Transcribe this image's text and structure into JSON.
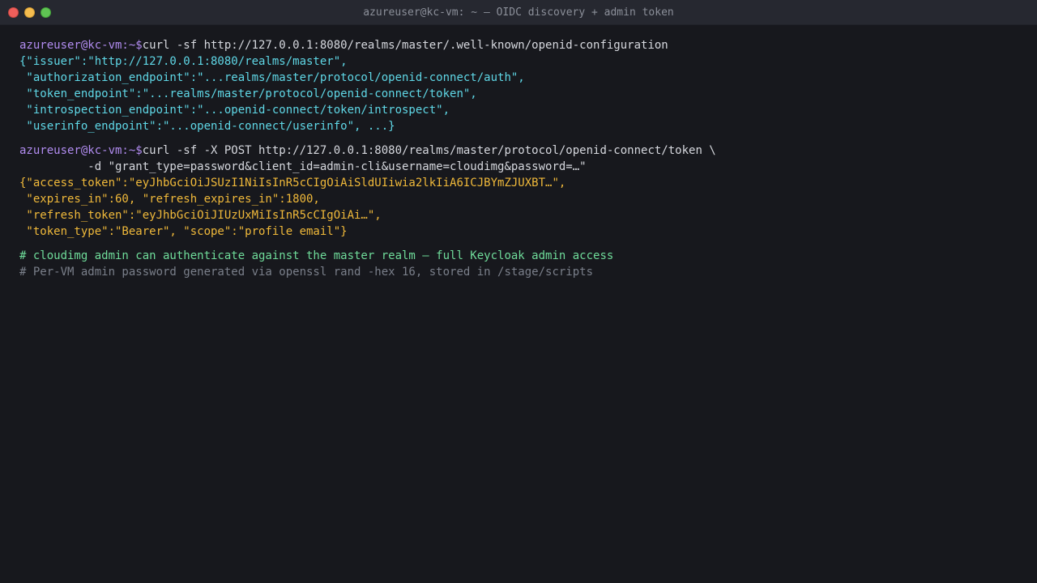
{
  "window": {
    "title": "azureuser@kc-vm: ~ — OIDC discovery + admin token"
  },
  "prompt": "azureuser@kc-vm:~$",
  "block1": {
    "command": "curl -sf http://127.0.0.1:8080/realms/master/.well-known/openid-configuration",
    "lines": [
      "{\"issuer\":\"http://127.0.0.1:8080/realms/master\",",
      " \"authorization_endpoint\":\"...realms/master/protocol/openid-connect/auth\",",
      " \"token_endpoint\":\"...realms/master/protocol/openid-connect/token\",",
      " \"introspection_endpoint\":\"...openid-connect/token/introspect\",",
      " \"userinfo_endpoint\":\"...openid-connect/userinfo\", ...}"
    ]
  },
  "block2": {
    "command": "curl -sf -X POST http://127.0.0.1:8080/realms/master/protocol/openid-connect/token \\",
    "continuation": "          -d \"grant_type=password&client_id=admin-cli&username=cloudimg&password=…\"",
    "lines": [
      "{\"access_token\":\"eyJhbGciOiJSUzI1NiIsInR5cCIgOiAiSldUIiwia2lkIiA6ICJBYmZJUXBT…\",",
      " \"expires_in\":60, \"refresh_expires_in\":1800,",
      " \"refresh_token\":\"eyJhbGciOiJIUzUxMiIsInR5cCIgOiAi…\",",
      " \"token_type\":\"Bearer\", \"scope\":\"profile email\"}"
    ]
  },
  "comments": {
    "highlight": "# cloudimg admin can authenticate against the master realm — full Keycloak admin access",
    "note": "# Per-VM admin password generated via openssl rand -hex 16, stored in /stage/scripts"
  }
}
